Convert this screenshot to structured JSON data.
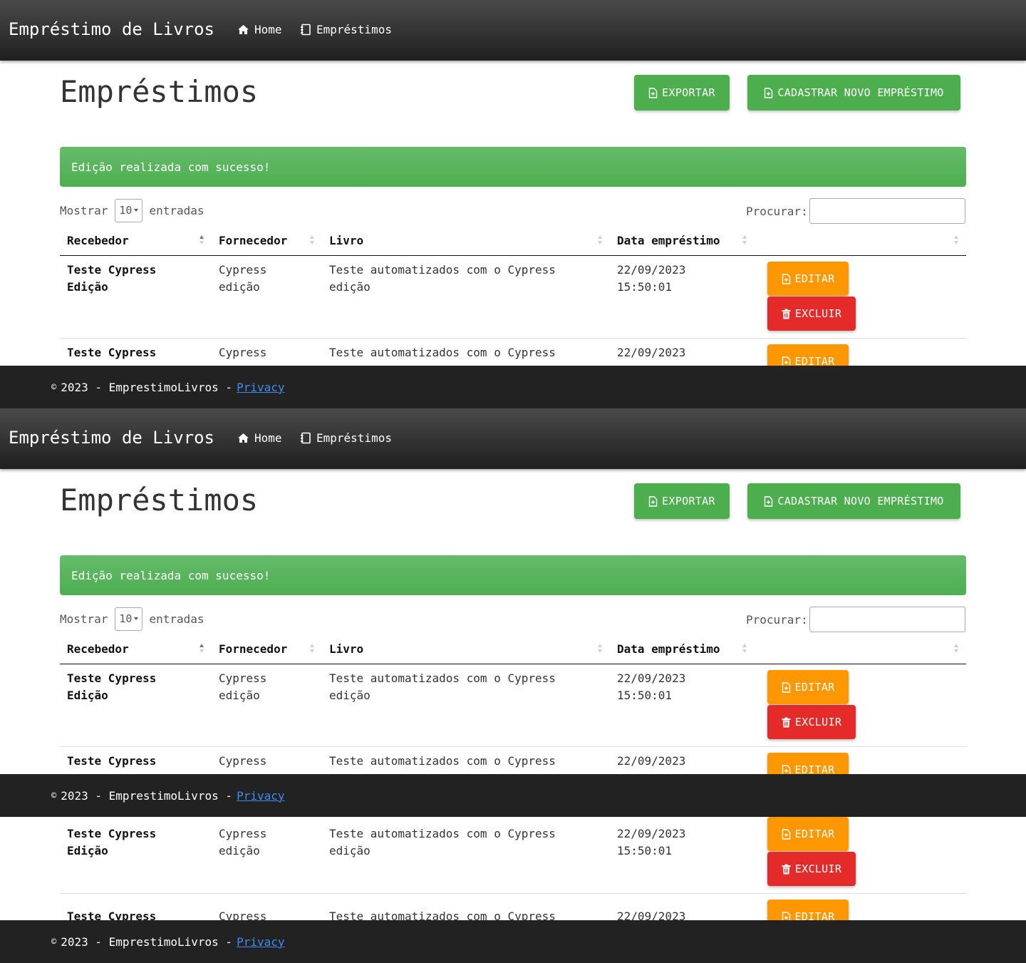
{
  "nav": {
    "brand": "Empréstimo de Livros",
    "links": [
      {
        "label": "Home",
        "icon": "home-icon"
      },
      {
        "label": "Empréstimos",
        "icon": "notebook-icon"
      }
    ]
  },
  "page": {
    "title": "Empréstimos",
    "export_label": "EXPORTAR",
    "new_label": "CADASTRAR NOVO EMPRÉSTIMO",
    "alert": "Edição realizada com sucesso!"
  },
  "table_controls": {
    "show_label": "Mostrar",
    "page_size": "10",
    "entries_label": "entradas",
    "search_label": "Procurar:",
    "search_value": ""
  },
  "table": {
    "columns": [
      "Recebedor",
      "Fornecedor",
      "Livro",
      "Data empréstimo",
      ""
    ],
    "rows": [
      {
        "recebedor": [
          "Teste Cypress",
          "Edição"
        ],
        "fornecedor": [
          "Cypress",
          "edição"
        ],
        "livro": [
          "Teste automatizados com o Cypress",
          "edição"
        ],
        "data": [
          "22/09/2023",
          "15:50:01"
        ]
      },
      {
        "recebedor": [
          "Teste Cypress",
          ""
        ],
        "fornecedor": [
          "Cypress",
          ""
        ],
        "livro": [
          "Teste automatizados com o Cypress",
          ""
        ],
        "data": [
          "22/09/2023",
          ""
        ]
      }
    ],
    "edit_label": "EDITAR",
    "delete_label": "EXCLUIR"
  },
  "footer": {
    "copy_symbol": "©",
    "text": "2023 - EmprestimoLivros -",
    "link": "Privacy"
  },
  "colors": {
    "navbar": "#2b2b2b",
    "green": "#4cae4c",
    "orange": "#ff9800",
    "red": "#e52a2a",
    "footer": "#222222",
    "link": "#3b8ef0"
  }
}
